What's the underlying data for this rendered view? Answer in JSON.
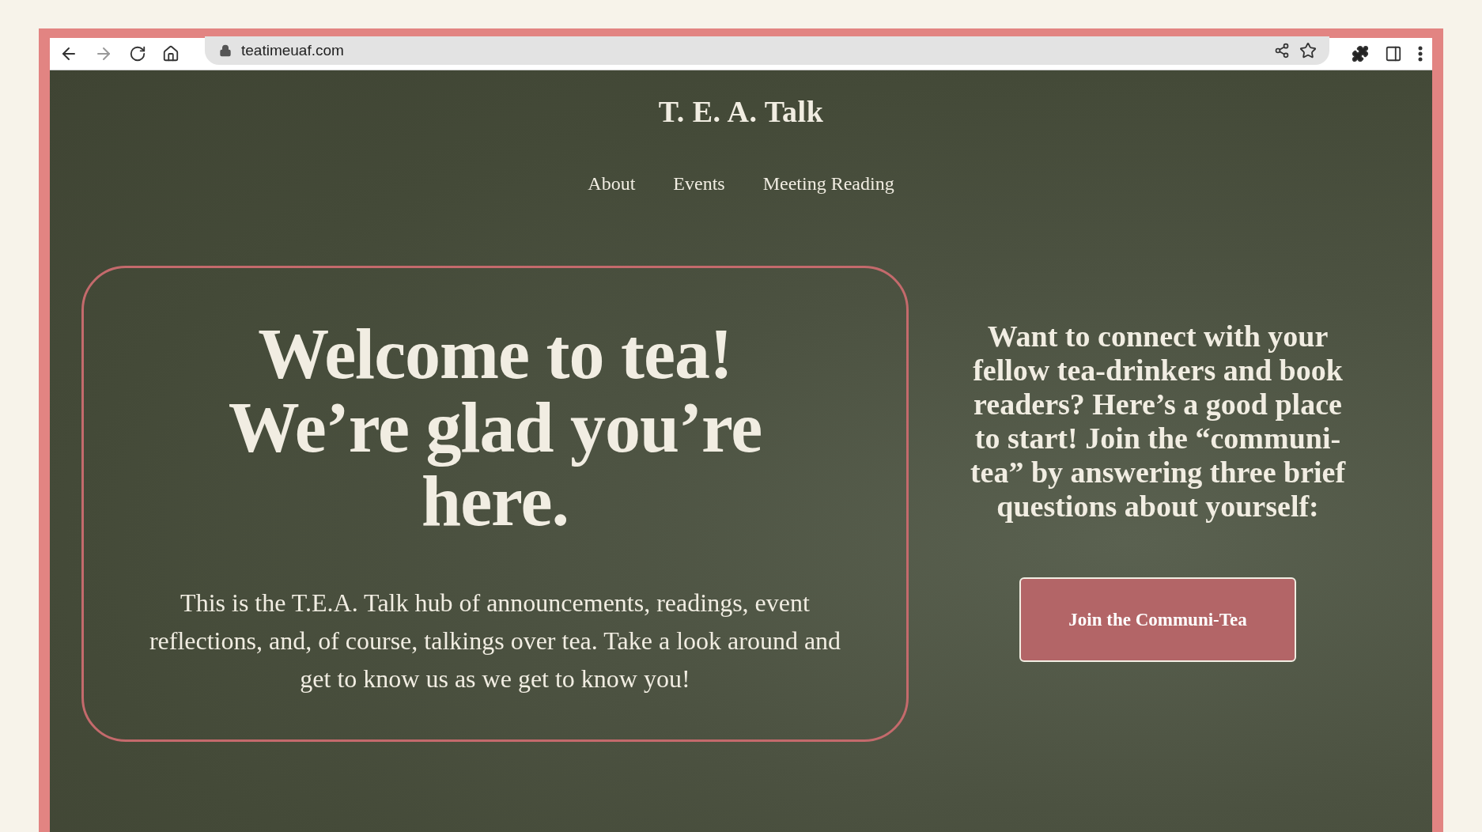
{
  "browser": {
    "url": "teatimeuaf.com",
    "back_disabled": false,
    "forward_disabled": true
  },
  "site": {
    "title": "T. E. A. Talk",
    "nav": [
      {
        "label": "About"
      },
      {
        "label": "Events"
      },
      {
        "label": "Meeting Reading"
      }
    ]
  },
  "welcome": {
    "heading": "Welcome to tea! We’re glad you’re here.",
    "body": "This is the T.E.A. Talk  hub of announcements, readings, event reflections, and, of course, talkings over tea. Take a look around and get to know us as we get to know you!"
  },
  "join": {
    "prompt": "Want to connect with your fellow tea-drinkers and book readers? Here’s a good place to start! Join the “communi-tea” by answering three brief questions about yourself:",
    "button": "Join the Communi-Tea"
  }
}
